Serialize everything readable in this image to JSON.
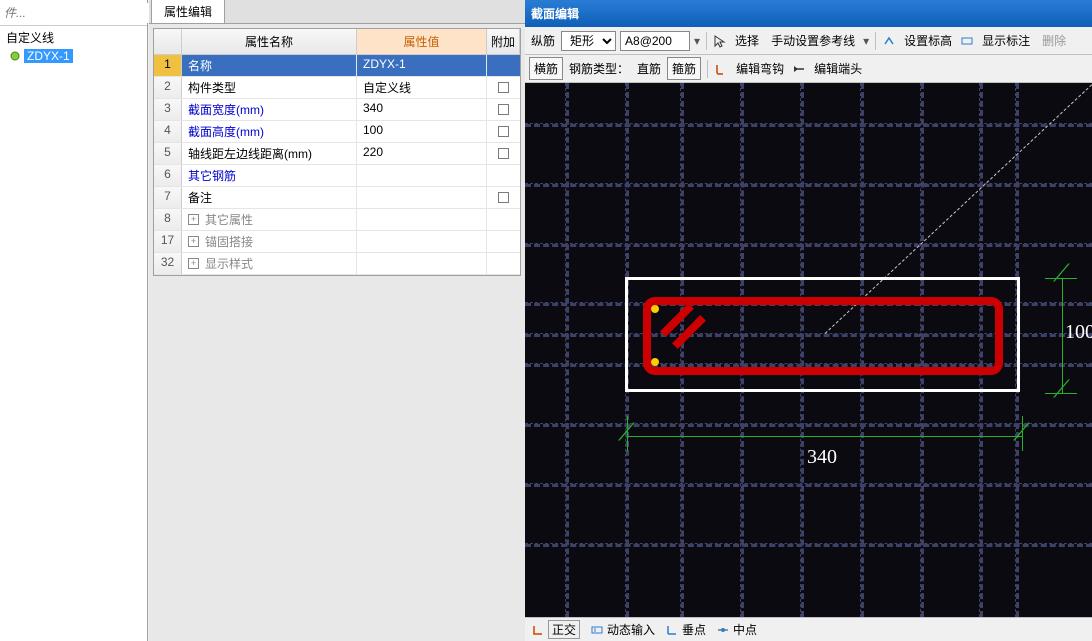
{
  "sidebar": {
    "search_placeholder": "件...",
    "root_label": "自定义线",
    "item_label": "ZDYX-1"
  },
  "propertyPanel": {
    "tab_label": "属性编辑",
    "header_name": "属性名称",
    "header_value": "属性值",
    "header_add": "附加",
    "rows": [
      {
        "num": "1",
        "name": "名称",
        "value": "ZDYX-1",
        "blue": false,
        "chk": false
      },
      {
        "num": "2",
        "name": "构件类型",
        "value": "自定义线",
        "blue": false,
        "chk": true
      },
      {
        "num": "3",
        "name": "截面宽度(mm)",
        "value": "340",
        "blue": true,
        "chk": true
      },
      {
        "num": "4",
        "name": "截面高度(mm)",
        "value": "100",
        "blue": true,
        "chk": true
      },
      {
        "num": "5",
        "name": "轴线距左边线距离(mm)",
        "value": "220",
        "blue": false,
        "chk": true
      },
      {
        "num": "6",
        "name": "其它钢筋",
        "value": "",
        "blue": true,
        "chk": false
      },
      {
        "num": "7",
        "name": "备注",
        "value": "",
        "blue": false,
        "chk": true
      }
    ],
    "exp_rows": [
      {
        "num": "8",
        "name": "其它属性"
      },
      {
        "num": "17",
        "name": "锚固搭接"
      },
      {
        "num": "32",
        "name": "显示样式"
      }
    ]
  },
  "rightPanel": {
    "title": "截面编辑",
    "toolbar1": {
      "label1": "纵筋",
      "select1": "矩形",
      "input1": "A8@200",
      "btn_select": "选择",
      "btn_manual": "手动设置参考线",
      "btn_setmark": "设置标高",
      "btn_showlabel": "显示标注",
      "btn_delete": "删除"
    },
    "toolbar2": {
      "btn_horiz": "横筋",
      "label_type": "钢筋类型：",
      "val_type": "直筋",
      "btn_hoop": "箍筋",
      "btn_edithook": "编辑弯钩",
      "btn_editend": "编辑端头"
    },
    "dims": {
      "width": "340",
      "height": "100"
    },
    "status": {
      "ortho": "正交",
      "dyninput": "动态输入",
      "perp": "垂点",
      "mid": "中点"
    }
  }
}
